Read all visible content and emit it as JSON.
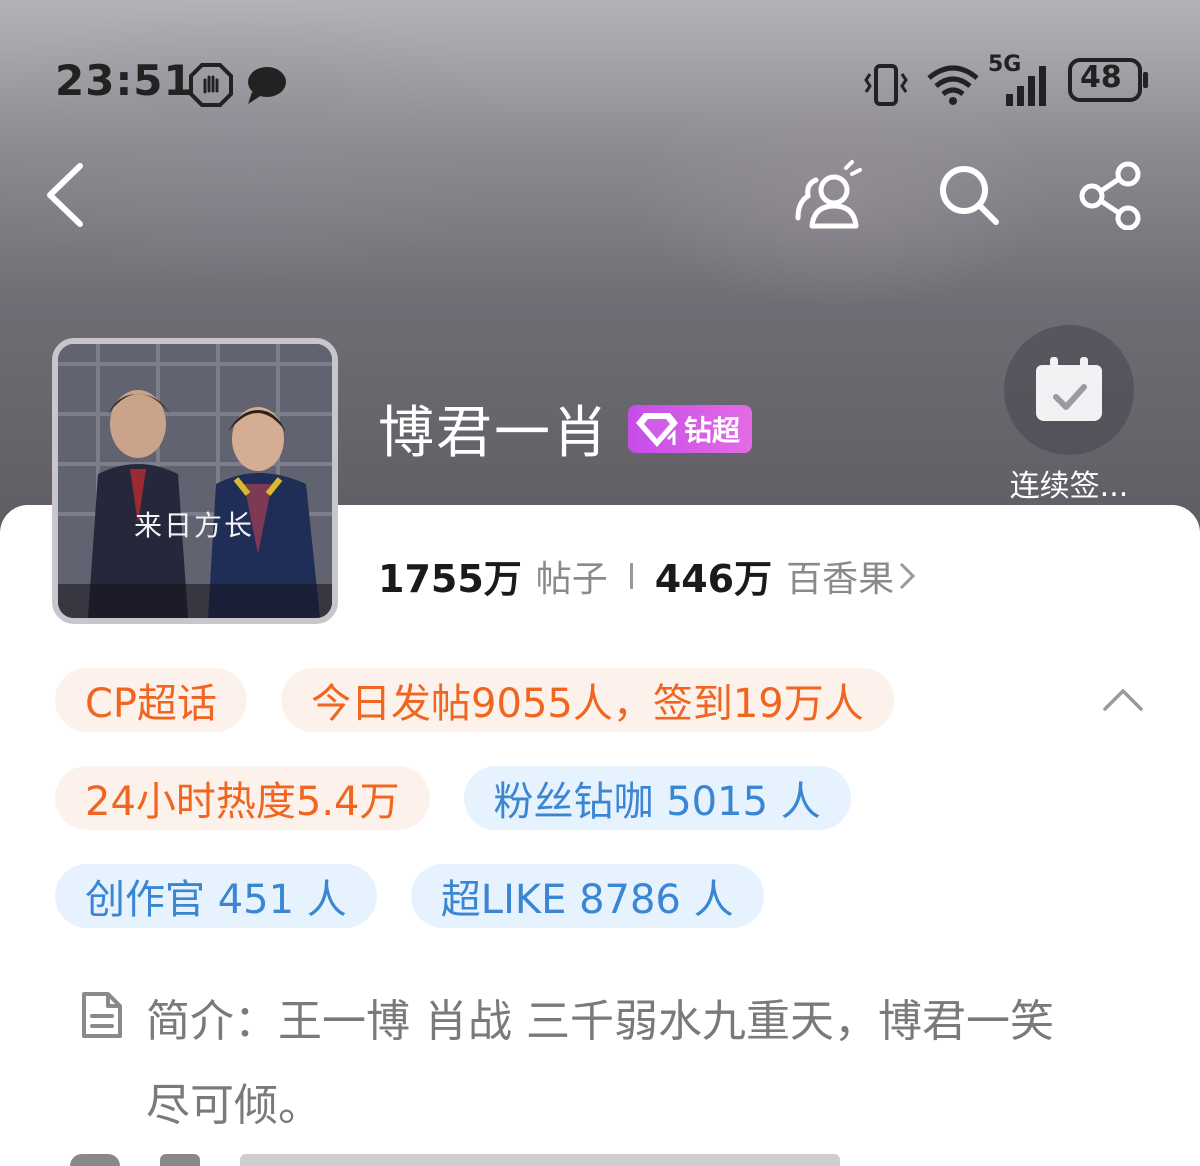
{
  "status_bar": {
    "time": "23:51",
    "network": "5G",
    "battery": "48",
    "icons": [
      "hand-stop-icon",
      "chat-bubble-icon",
      "vibrate-icon",
      "wifi-icon",
      "signal-icon",
      "battery-icon"
    ]
  },
  "nav": {
    "back_icon": "chevron-left-icon",
    "actions": [
      "group-chat-icon",
      "search-icon",
      "share-icon"
    ]
  },
  "header": {
    "title": "博君一肖",
    "badge_label": "钻超",
    "checkin_label": "连续签..."
  },
  "avatar": {
    "caption": "来日方长"
  },
  "stats": {
    "posts_num": "1755万",
    "posts_label": "帖子",
    "fans_num": "446万",
    "fans_label": "百香果"
  },
  "tags": {
    "row1": [
      "CP超话",
      "今日发帖9055人，签到19万人"
    ],
    "row2": [
      "24小时热度5.4万",
      "粉丝钻咖 5015 人"
    ],
    "row3": [
      "创作官 451 人",
      "超LIKE 8786 人"
    ]
  },
  "intro": {
    "text": "简介：王一博 肖战 三千弱水九重天，博君一笑尽可倾。"
  },
  "colors": {
    "orange": "#f0651f",
    "blue": "#3b86d3",
    "badge": "#c54de8"
  }
}
